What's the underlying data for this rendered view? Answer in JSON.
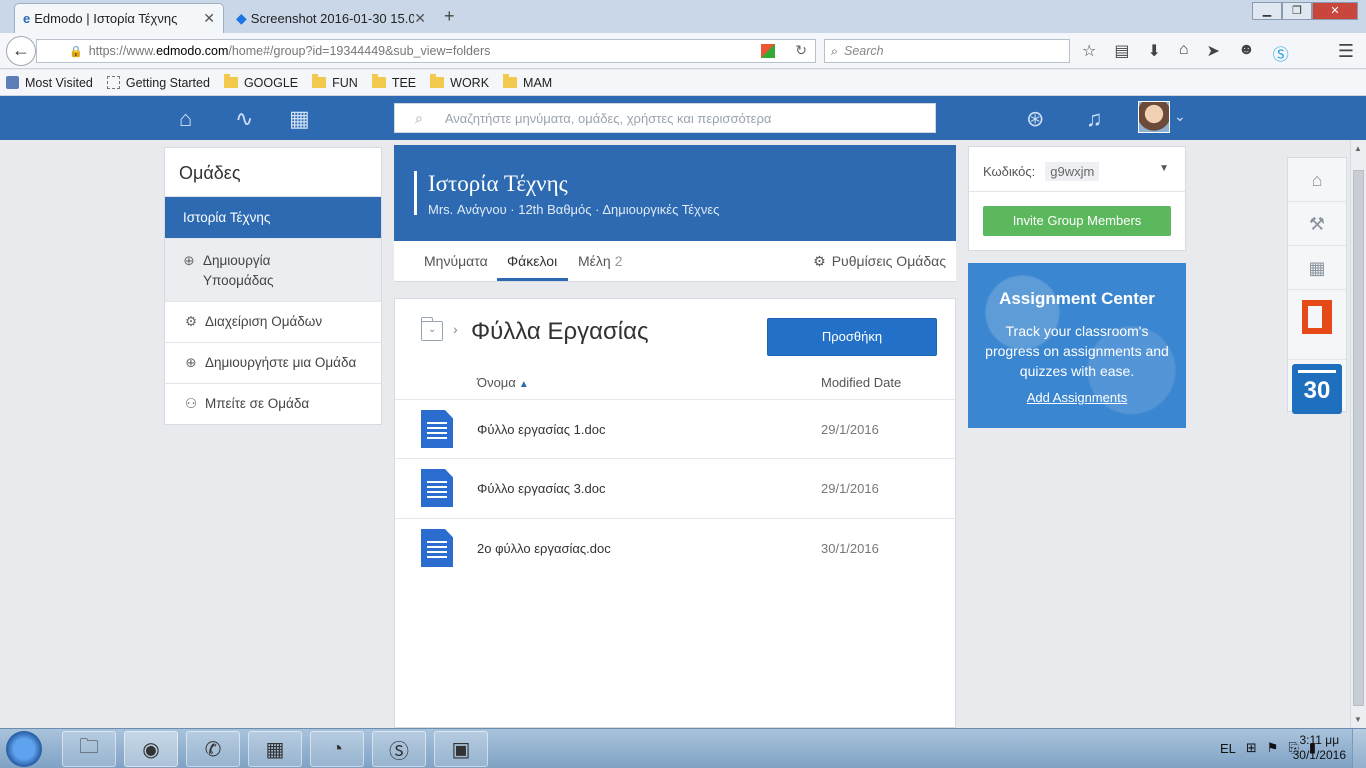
{
  "browser": {
    "tabs": [
      {
        "title": "Edmodo | Ιστορία Τέχνης",
        "close": "✕"
      },
      {
        "title": "Screenshot 2016-01-30 15.0...",
        "close": "✕"
      }
    ],
    "new_tab": "+",
    "url": {
      "scheme": "https://www.",
      "host": "edmodo.com",
      "path": "/home#/group?id=19344449&sub_view=folders"
    },
    "search_placeholder": "Search",
    "bookmarks": [
      "Most Visited",
      "Getting Started",
      "GOOGLE",
      "FUN",
      "TEE",
      "WORK",
      "MAM"
    ]
  },
  "edmodo": {
    "search_placeholder": "Αναζητήστε μηνύματα, ομάδες, χρήστες και περισσότερα"
  },
  "sidebar": {
    "title": "Ομάδες",
    "items": [
      {
        "label": "Ιστορία Τέχνης"
      },
      {
        "label": "Δημιουργία Υποομάδας"
      },
      {
        "label": "Διαχείριση Ομάδων"
      },
      {
        "label": "Δημιουργήστε μια Ομάδα"
      },
      {
        "label": "Μπείτε σε Ομάδα"
      }
    ]
  },
  "group": {
    "title": "Ιστορία Τέχνης",
    "subtitle": "Mrs. Ανάγνου · 12th Βαθμός · Δημιουργικές Τέχνες",
    "tabs": [
      {
        "label": "Μηνύματα"
      },
      {
        "label": "Φάκελοι"
      },
      {
        "label": "Μέλη",
        "count": "2"
      }
    ],
    "settings_label": "Ρυθμίσεις Ομάδας"
  },
  "folder": {
    "title": "Φύλλα Εργασίας",
    "add_button": "Προσθήκη",
    "columns": {
      "name": "Όνομα",
      "date": "Modified Date"
    },
    "files": [
      {
        "name": "Φύλλο εργασίας 1.doc",
        "date": "29/1/2016"
      },
      {
        "name": "Φύλλο εργασίας 3.doc",
        "date": "29/1/2016"
      },
      {
        "name": "2ο φύλλο εργασίας.doc",
        "date": "30/1/2016"
      }
    ]
  },
  "right": {
    "code_label": "Κωδικός:",
    "code_value": "g9wxjm",
    "invite_button": "Invite Group Members",
    "assignment": {
      "title": "Assignment Center",
      "text": "Track your classroom's progress on assignments and quizzes with ease.",
      "link": "Add Assignments"
    },
    "calendar_day": "30"
  },
  "taskbar": {
    "lang": "EL",
    "time": "3:11 μμ",
    "date": "30/1/2016"
  },
  "colors": {
    "brand_blue": "#2d6ab1",
    "add_button": "#2370c8",
    "invite_green": "#5cb85c",
    "office_orange": "#e64a19"
  }
}
